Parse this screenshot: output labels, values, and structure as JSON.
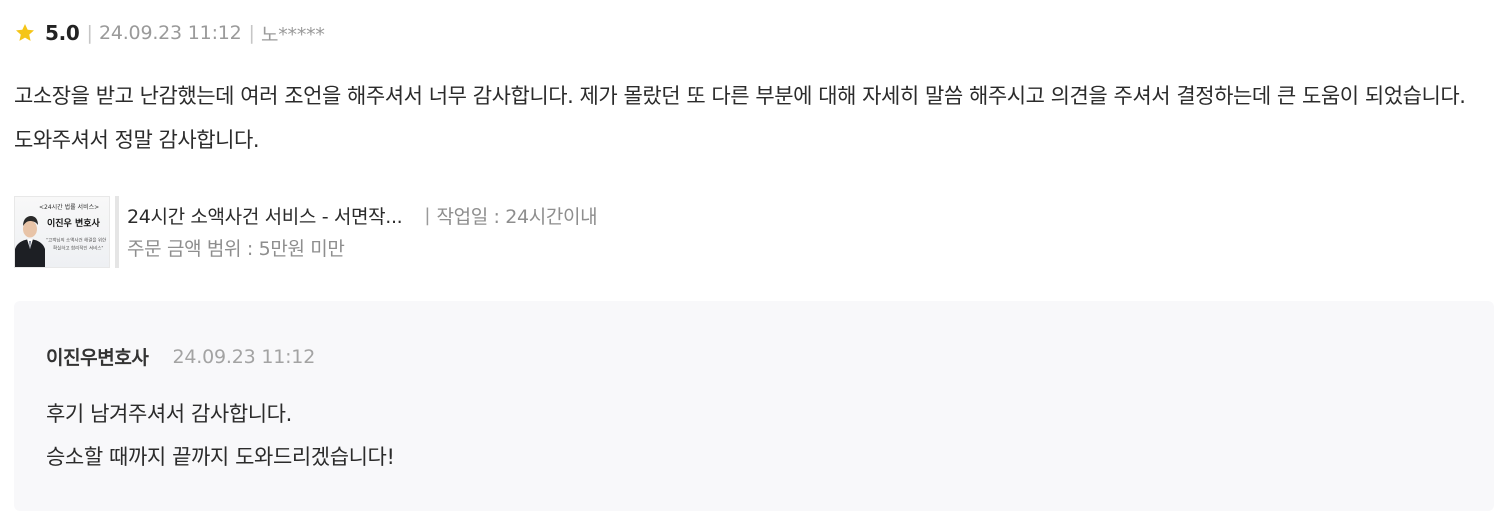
{
  "review": {
    "rating": "5.0",
    "separator": "|",
    "date": "24.09.23 11:12",
    "author": "노*****",
    "body": "고소장을 받고 난감했는데 여러 조언을 해주셔서 너무 감사합니다. 제가 몰랐던 또 다른 부분에 대해 자세히 말씀 해주시고  의견을 주셔서 결정하는데 큰 도움이 되었습니다.도와주셔서 정말 감사합니다.",
    "star_color": "#f5c518"
  },
  "product": {
    "thumbnail": {
      "caption": "<24시간 법률 서비스>",
      "name": "이진우 변호사",
      "line1": "\"고객님의 소액사건 해결을 위한",
      "line2": "확실하고 합리적인 서비스\""
    },
    "title": "24시간 소액사건 서비스 - 서면작...",
    "separator": "|",
    "work_period": "작업일 : 24시간이내",
    "price_range": "주문 금액 범위 : 5만원 미만"
  },
  "reply": {
    "author": "이진우변호사",
    "date": "24.09.23 11:12",
    "line1": "후기 남겨주셔서 감사합니다.",
    "line2": "승소할 때까지 끝까지 도와드리겠습니다!"
  }
}
